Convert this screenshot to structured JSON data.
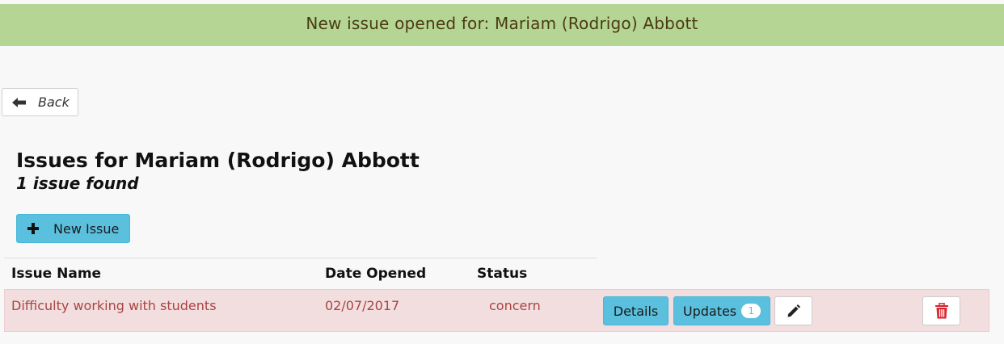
{
  "banner": {
    "message": "New issue opened for: Mariam (Rodrigo) Abbott"
  },
  "back_button": {
    "label": "Back",
    "icon": "arrow-left-icon"
  },
  "page": {
    "title": "Issues for Mariam (Rodrigo) Abbott",
    "count_text": "1 issue found"
  },
  "new_issue_button": {
    "label": "New Issue",
    "icon": "plus-icon"
  },
  "table": {
    "headers": [
      "Issue Name",
      "Date Opened",
      "Status"
    ],
    "rows": [
      {
        "issue_name": "Difficulty working with students",
        "date_opened": "02/07/2017",
        "status": "concern",
        "details_label": "Details",
        "updates_label": "Updates",
        "updates_count": "1",
        "edit_icon": "pencil-icon",
        "delete_icon": "trash-icon"
      }
    ]
  },
  "colors": {
    "banner_bg": "#b5d594",
    "info_button": "#5bc0de",
    "danger_row_bg": "#f2dede",
    "danger_text": "#a94442",
    "delete_icon": "#d9232d"
  }
}
